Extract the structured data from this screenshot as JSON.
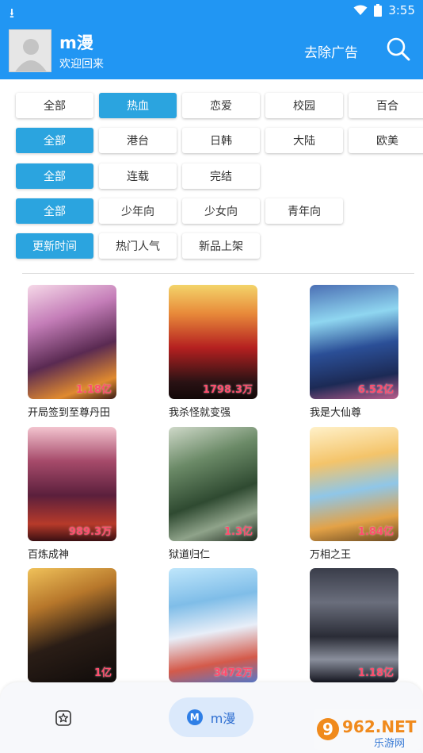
{
  "status_bar": {
    "time": "3:55"
  },
  "header": {
    "app_title": "m漫",
    "welcome": "欢迎回来",
    "remove_ads": "去除广告"
  },
  "filters": {
    "genre": [
      {
        "label": "全部",
        "active": false
      },
      {
        "label": "热血",
        "active": true
      },
      {
        "label": "恋爱",
        "active": false
      },
      {
        "label": "校园",
        "active": false
      },
      {
        "label": "百合",
        "active": false
      }
    ],
    "region": [
      {
        "label": "全部",
        "active": true
      },
      {
        "label": "港台",
        "active": false
      },
      {
        "label": "日韩",
        "active": false
      },
      {
        "label": "大陆",
        "active": false
      },
      {
        "label": "欧美",
        "active": false
      }
    ],
    "status": [
      {
        "label": "全部",
        "active": true
      },
      {
        "label": "连载",
        "active": false
      },
      {
        "label": "完结",
        "active": false
      }
    ],
    "audience": [
      {
        "label": "全部",
        "active": true
      },
      {
        "label": "少年向",
        "active": false
      },
      {
        "label": "少女向",
        "active": false
      },
      {
        "label": "青年向",
        "active": false
      }
    ],
    "sort": [
      {
        "label": "更新时间",
        "active": true
      },
      {
        "label": "热门人气",
        "active": false
      },
      {
        "label": "新品上架",
        "active": false
      }
    ]
  },
  "comics": [
    {
      "title": "开局签到至尊丹田",
      "views": "1.18亿"
    },
    {
      "title": "我杀怪就变强",
      "views": "1798.3万"
    },
    {
      "title": "我是大仙尊",
      "views": "6.52亿"
    },
    {
      "title": "百炼成神",
      "views": "989.3万"
    },
    {
      "title": "狱道归仁",
      "views": "1.3亿"
    },
    {
      "title": "万相之王",
      "views": "1.84亿"
    },
    {
      "title": "",
      "views": "1亿"
    },
    {
      "title": "",
      "views": "3472万"
    },
    {
      "title": "",
      "views": "1.18亿"
    }
  ],
  "bottom_nav": {
    "active_label": "m漫"
  },
  "watermark": {
    "text": "962.NET",
    "sub": "乐游网"
  },
  "colors": {
    "primary": "#2196f3",
    "chip_active": "#2ba4df",
    "count": "#ff4d6d"
  }
}
